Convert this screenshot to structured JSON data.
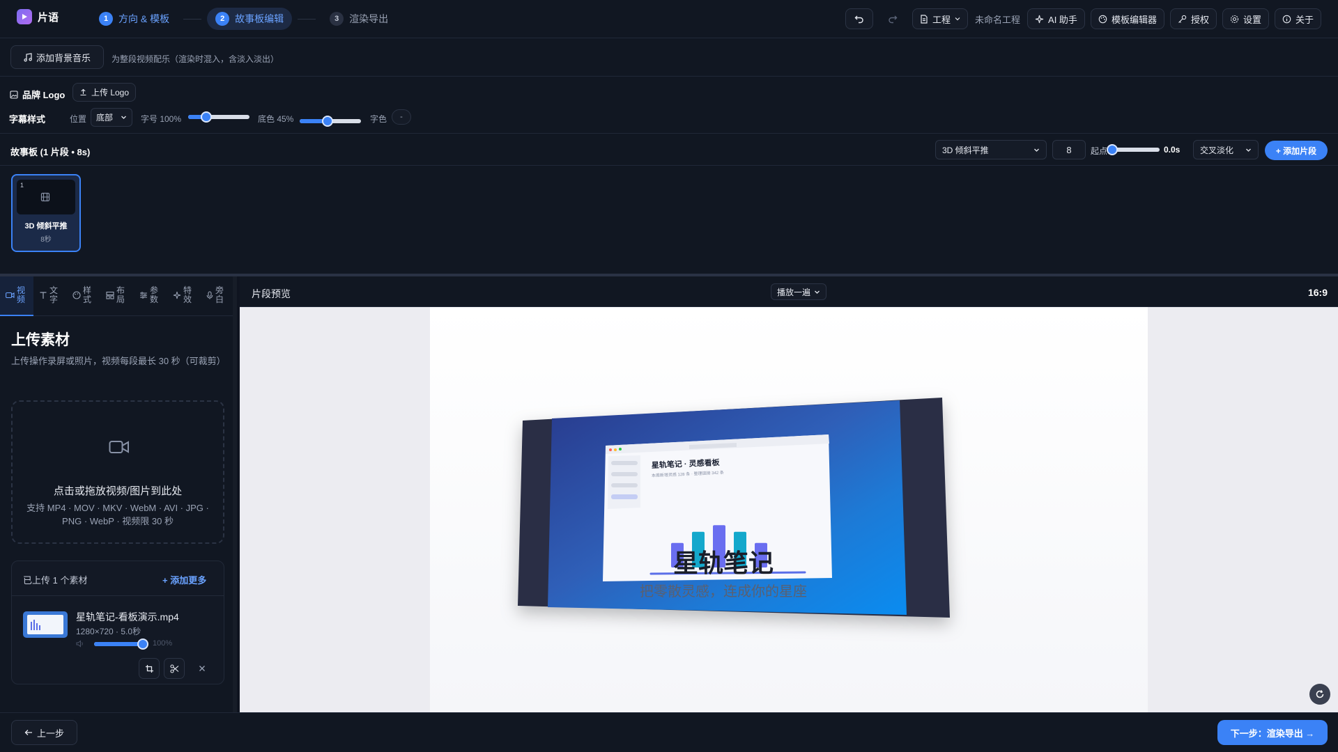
{
  "app": {
    "name": "片语"
  },
  "steps": [
    {
      "num": "1",
      "label": "方向 & 模板"
    },
    {
      "num": "2",
      "label": "故事板编辑"
    },
    {
      "num": "3",
      "label": "渲染导出"
    }
  ],
  "toolbar": {
    "project_label": "工程",
    "project_name": "未命名工程",
    "ai_label": "AI 助手",
    "template_editor_label": "模板编辑器",
    "license_label": "授权",
    "settings_label": "设置",
    "about_label": "关于"
  },
  "music": {
    "button_label": "添加背景音乐",
    "hint": "为整段视频配乐（渲染时混入，含淡入淡出）"
  },
  "brand": {
    "title": "品牌 Logo",
    "upload_label": "上传 Logo"
  },
  "subtitle_style": {
    "title": "字幕样式",
    "position_label": "位置",
    "position_value": "底部",
    "size_label": "字号 100%",
    "size_value": 0.3,
    "bg_label": "底色 45%",
    "bg_value": 0.45,
    "color_label": "字色",
    "color_value": "-"
  },
  "storyboard": {
    "title": "故事板 (1 片段 • 8s)",
    "transition_template": "3D 倾斜平推",
    "duration_value": "8",
    "start_label": "起点",
    "start_value": "0.0s",
    "transition": "交叉淡化",
    "add_label": "+ 添加片段",
    "clips": [
      {
        "index": "1",
        "name": "3D 倾斜平推",
        "duration": "8秒"
      }
    ]
  },
  "left_tabs": [
    {
      "icon": "video-icon",
      "label": "视频"
    },
    {
      "icon": "text-icon",
      "label": "文字"
    },
    {
      "icon": "palette-icon",
      "label": "样式"
    },
    {
      "icon": "layout-icon",
      "label": "布局"
    },
    {
      "icon": "sliders-icon",
      "label": "参数"
    },
    {
      "icon": "sparkle-icon",
      "label": "特效"
    },
    {
      "icon": "mic-icon",
      "label": "旁白"
    }
  ],
  "upload": {
    "title": "上传素材",
    "desc": "上传操作录屏或照片，视频每段最长 30 秒（可裁剪）",
    "drop_title": "点击或拖放视频/图片到此处",
    "drop_formats": "支持 MP4 · MOV · MKV · WebM · AVI · JPG · PNG · WebP · 视频限 30 秒",
    "count_label": "已上传 1 个素材",
    "add_more_label": "+ 添加更多",
    "file": {
      "name": "星轨笔记-看板演示.mp4",
      "meta": "1280×720 · 5.0秒",
      "volume_label": "100%",
      "volume_value": 1.0
    }
  },
  "preview": {
    "title": "片段预览",
    "play_mode": "播放一遍",
    "aspect": "16:9",
    "scene": {
      "window_title": "星轨笔记 · 灵感看板",
      "window_sub": "本周新增灵感 128 条 · 整理链接 342 条",
      "bars": [
        0.55,
        0.8,
        0.95,
        0.8,
        0.55
      ],
      "headline": "星轨笔记",
      "tagline": "把零散灵感，连成你的星座"
    }
  },
  "footer": {
    "back_label": "上一步",
    "next_label": "下一步：渲染导出 →"
  },
  "colors": {
    "accent": "#3b82f6",
    "bg": "#0f1420",
    "panel": "#111722",
    "border": "#2b3344"
  }
}
